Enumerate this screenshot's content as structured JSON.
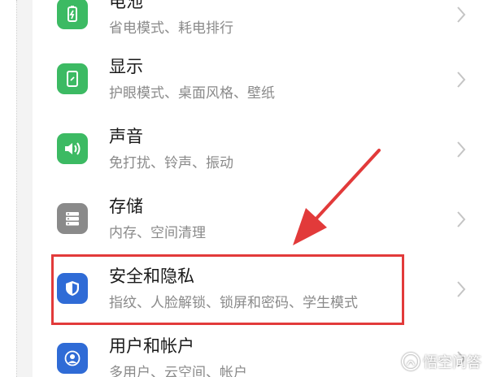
{
  "settings": {
    "items": [
      {
        "title": "电池",
        "subtitle": "省电模式、耗电排行",
        "icon": "battery-icon",
        "color": "#3cba63"
      },
      {
        "title": "显示",
        "subtitle": "护眼模式、桌面风格、壁纸",
        "icon": "display-icon",
        "color": "#3cba63"
      },
      {
        "title": "声音",
        "subtitle": "免打扰、铃声、振动",
        "icon": "sound-icon",
        "color": "#3cba63"
      },
      {
        "title": "存储",
        "subtitle": "内存、空间清理",
        "icon": "storage-icon",
        "color": "#8a8a8a"
      },
      {
        "title": "安全和隐私",
        "subtitle": "指纹、人脸解锁、锁屏和密码、学生模式",
        "icon": "shield-icon",
        "color": "#2f6bd6"
      },
      {
        "title": "用户和帐户",
        "subtitle": "多用户、云空间、帐户",
        "icon": "user-icon",
        "color": "#2f6bd6"
      }
    ]
  },
  "annotation": {
    "highlight_color": "#e23a3a"
  },
  "watermark": {
    "text": "悟空问答"
  }
}
